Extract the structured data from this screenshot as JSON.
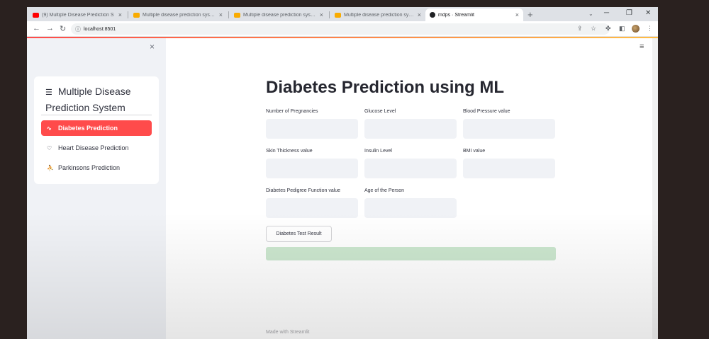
{
  "browser": {
    "tabs": [
      {
        "title": "(9) Multiple Disease Prediction S",
        "favicon_color": "#ff0000"
      },
      {
        "title": "Multiple disease prediction system",
        "favicon_color": "#f9ab00"
      },
      {
        "title": "Multiple disease prediction system",
        "favicon_color": "#f9ab00"
      },
      {
        "title": "Multiple disease prediction system",
        "favicon_color": "#f9ab00"
      },
      {
        "title": "mdps · Streamlit",
        "favicon_color": "#202124"
      }
    ],
    "new_tab": "+",
    "url": "localhost:8501",
    "window_controls": {
      "minimize": "─",
      "restore": "❐",
      "close": "✕"
    }
  },
  "sidebar": {
    "close": "×",
    "title": "Multiple Disease Prediction System",
    "items": [
      {
        "icon": "activity-icon",
        "glyph": "∿",
        "label": "Diabetes Prediction",
        "active": true
      },
      {
        "icon": "heart-icon",
        "glyph": "♡",
        "label": "Heart Disease Prediction",
        "active": false
      },
      {
        "icon": "person-icon",
        "glyph": "⛹",
        "label": "Parkinsons Prediction",
        "active": false
      }
    ]
  },
  "main": {
    "menu": "≡",
    "title": "Diabetes Prediction using ML",
    "fields": [
      {
        "label": "Number of Pregnancies",
        "value": ""
      },
      {
        "label": "Glucose Level",
        "value": ""
      },
      {
        "label": "Blood Pressure value",
        "value": ""
      },
      {
        "label": "Skin Thickness value",
        "value": ""
      },
      {
        "label": "Insulin Level",
        "value": ""
      },
      {
        "label": "BMI value",
        "value": ""
      },
      {
        "label": "Diabetes Pedigree Function value",
        "value": ""
      },
      {
        "label": "Age of the Person",
        "value": ""
      }
    ],
    "button": "Diabetes Test Result",
    "result": "",
    "footer": "Made with Streamlit"
  },
  "colors": {
    "accent": "#ff4b4b",
    "sidebar_bg": "#f0f2f6",
    "success_bg": "#cce7cf"
  }
}
